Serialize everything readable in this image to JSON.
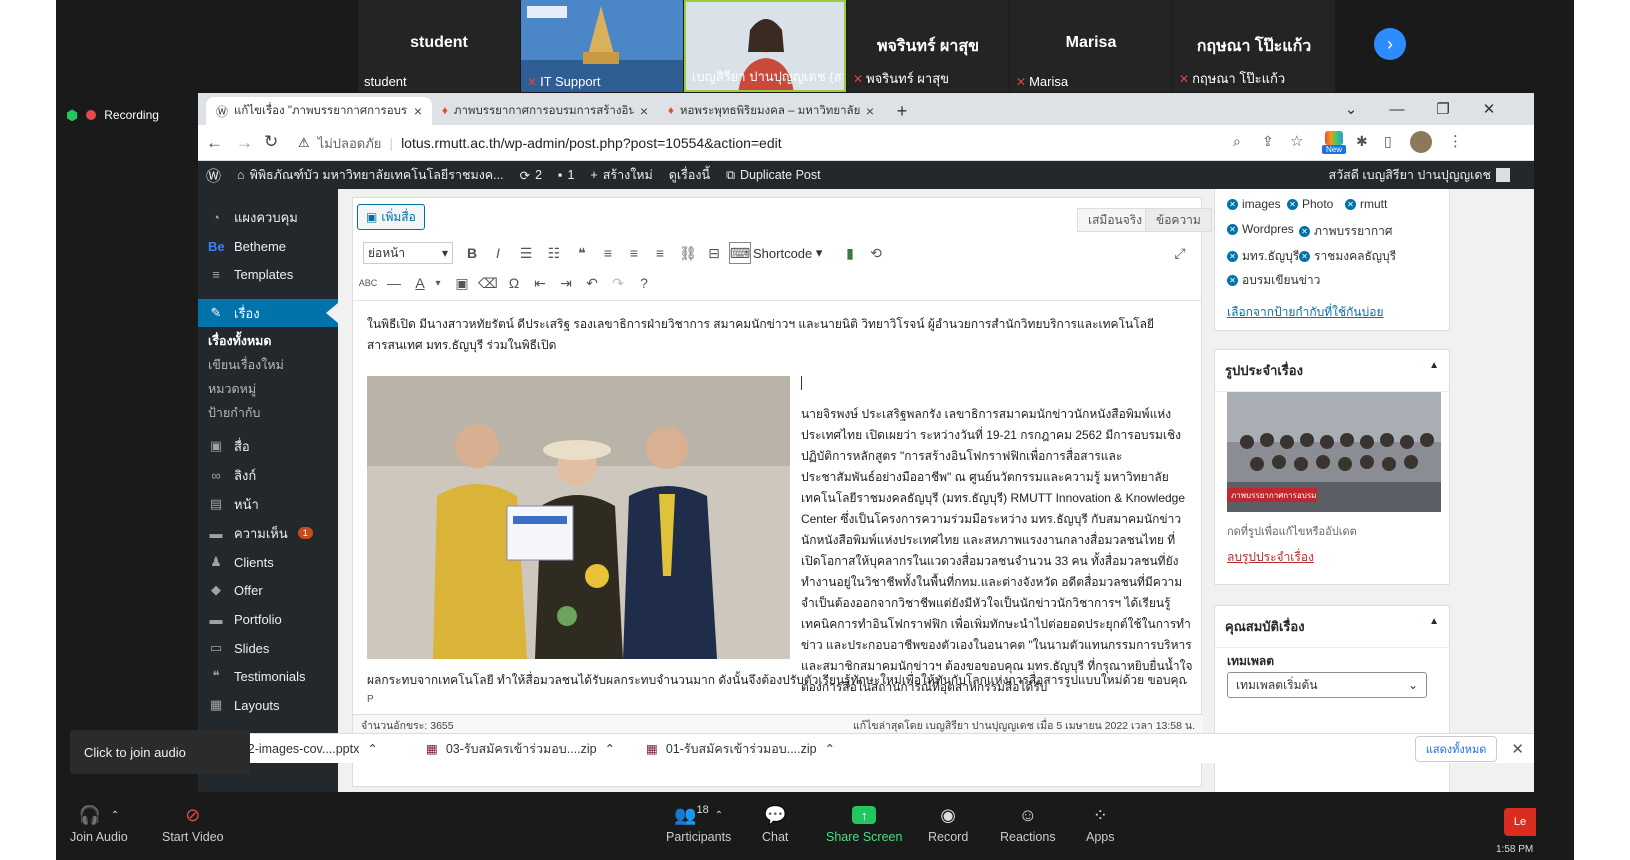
{
  "zoom": {
    "tiles": [
      {
        "big": "student",
        "small": "student"
      },
      {
        "big": "",
        "small": "IT Support"
      },
      {
        "big": "",
        "small": "เบญสิรียา ปานปุญญเดช (สวส)"
      },
      {
        "big": "พจรินทร์ ผาสุข",
        "small": "พจรินทร์ ผาสุข"
      },
      {
        "big": "Marisa",
        "small": "Marisa"
      },
      {
        "big": "กฤษณา โป๊ะแก้ว",
        "small": "กฤษณา โป๊ะแก้ว"
      }
    ],
    "recording_label": "Recording",
    "tooltip": "Click to join audio",
    "participants_count": "18",
    "toolbar": [
      {
        "label": "Join Audio",
        "icon": "headphones-icon"
      },
      {
        "label": "Start Video",
        "icon": "video-off-icon"
      },
      {
        "label": "Participants",
        "icon": "participants-icon"
      },
      {
        "label": "Chat",
        "icon": "chat-icon"
      },
      {
        "label": "Share Screen",
        "icon": "share-screen-icon"
      },
      {
        "label": "Record",
        "icon": "record-icon"
      },
      {
        "label": "Reactions",
        "icon": "reactions-icon"
      },
      {
        "label": "Apps",
        "icon": "apps-icon"
      }
    ],
    "right_edge_button": "Le",
    "clock": "1:58 PM",
    "share_color": "#22c55e"
  },
  "browser": {
    "tabs": [
      {
        "title": "แก้ไขเรื่อง \"ภาพบรรยากาศการอบรมเ"
      },
      {
        "title": "ภาพบรรยากาศการอบรมการสร้างอินโฟ"
      },
      {
        "title": "หอพระพุทธพิริยมงคล – มหาวิทยาลัยเ"
      }
    ],
    "insecure_label": "ไม่ปลอดภัย",
    "url": "lotus.rmutt.ac.th/wp-admin/post.php?post=10554&action=edit",
    "new_badge": "New"
  },
  "wp": {
    "adminbar": {
      "site": "พิพิธภัณฑ์บัว มหาวิทยาลัยเทคโนโลยีราชมงค...",
      "updates": "2",
      "comments": "1",
      "new": "สร้างใหม่",
      "view": "ดูเรื่องนี้",
      "duplicate": "Duplicate Post",
      "greeting": "สวัสดี เบญสิรียา ปานปุญญเดช"
    },
    "menu": [
      {
        "label": "แผงควบคุม",
        "icon": "dashboard-icon"
      },
      {
        "label": "Betheme",
        "icon": "betheme-icon"
      },
      {
        "label": "Templates",
        "icon": "templates-icon"
      },
      {
        "label": "เรื่อง",
        "icon": "pin-icon"
      },
      {
        "label": "สื่อ",
        "icon": "media-icon"
      },
      {
        "label": "ลิงก์",
        "icon": "link-icon"
      },
      {
        "label": "หน้า",
        "icon": "page-icon"
      },
      {
        "label": "ความเห็น",
        "icon": "comment-icon"
      },
      {
        "label": "Clients",
        "icon": "clients-icon"
      },
      {
        "label": "Offer",
        "icon": "offer-icon"
      },
      {
        "label": "Portfolio",
        "icon": "portfolio-icon"
      },
      {
        "label": "Slides",
        "icon": "slides-icon"
      },
      {
        "label": "Testimonials",
        "icon": "testimonials-icon"
      },
      {
        "label": "Layouts",
        "icon": "layouts-icon"
      }
    ],
    "submenu": [
      "เรื่องทั้งหมด",
      "เขียนเรื่องใหม่",
      "หมวดหมู่",
      "ป้ายกำกับ"
    ],
    "comments_badge": "1",
    "editor": {
      "add_media": "เพิ่มสื่อ",
      "visual_tab": "เสมือนจริง",
      "text_tab": "ข้อความ",
      "format": "ย่อหน้า",
      "shortcode": "Shortcode",
      "intro": "ในพิธีเปิด มีนางสาวหทัยรัตน์ ดีประเสริฐ รองเลขาธิการฝ่ายวิชาการ สมาคมนักข่าวฯ และนายนิติ วิทยาวิโรจน์ ผู้อำนวยการสำนักวิทยบริการและเทคโนโลยีสารสนเทศ มทร.ธัญบุรี ร่วมในพิธีเปิด",
      "body": "นายจิรพงษ์ ประเสริฐพลกรัง เลขาธิการสมาคมนักข่าวนักหนังสือพิมพ์แห่งประเทศไทย เปิดเผยว่า ระหว่างวันที่ 19-21 กรกฎาคม 2562 มีการอบรมเชิงปฏิบัติการหลักสูตร \"การสร้างอินโฟกราฟฟิกเพื่อการสื่อสารและประชาสัมพันธ์อย่างมืออาชีพ\" ณ ศูนย์นวัตกรรมและความรู้ มหาวิทยาลัยเทคโนโลยีราชมงคลธัญบุรี (มทร.ธัญบุรี) RMUTT Innovation & Knowledge Center ซึ่งเป็นโครงการความร่วมมือระหว่าง มทร.ธัญบุรี กับสมาคมนักข่าวนักหนังสือพิมพ์แห่งประเทศไทย และสหภาพแรงงานกลางสื่อมวลชนไทย ที่เปิดโอกาสให้บุคลากรในแวดวงสื่อมวลชนจำนวน 33 คน ทั้งสื่อมวลชนที่ยังทำงานอยู่ในวิชาชีพทั้งในพื้นที่กทม.และต่างจังหวัด อดีตสื่อมวลชนที่มีความจำเป็นต้องออกจากวิชาชีพแต่ยังมีหัวใจเป็นนักข่าวนักวิชาการฯ ได้เรียนรู้เทคนิคการทำอินโฟกราฟฟิก เพื่อเพิ่มทักษะนำไปต่อยอดประยุกต์ใช้ในการทำข่าว และประกอบอาชีพของตัวเองในอนาคต \"ในนามตัวแทนกรรมการบริหารและสมาชิกสมาคมนักข่าวฯ ต้องขอขอบคุณ มทร.ธัญบุรี ที่กรุณาหยิบยื่นน้ำใจต่องการสื่อในสถานการณ์ที่อุตสาหกรรมสื่อได้รับ",
      "bottom_line": "ผลกระทบจากเทคโนโลยี ทำให้สื่อมวลชนได้รับผลกระทบจำนวนมาก ดังนั้นจึงต้องปรับตัวเรียนรู้ทักษะใหม่เพื่อให้ทันกับโลกแห่งการสื่อสารรูปแบบใหม่ด้วย ขอบคุณที่เอื้อเฟื้อ",
      "path": "P",
      "word_count": "จำนวนอักขระ: 3655",
      "last_edit": "แก้ไขล่าสุดโดย เบญสิรียา ปานปุญญเดช เมื่อ 5 เมษายน 2022 เวลา 13:58 น."
    },
    "tags": [
      "images",
      "Photo",
      "rmutt",
      "Wordpres",
      "ภาพบรรยากาศ",
      "มทร.ธัญบุรี",
      "ราชมงคลธัญบุรี",
      "อบรมเขียนข่าว"
    ],
    "choose_tags": "เลือกจากป้ายกำกับที่ใช้กันบ่อย",
    "featured": {
      "title": "รูปประจำเรื่อง",
      "hint": "กดที่รูปเพื่อแก้ไขหรืออัปเดต",
      "remove": "ลบรูปประจำเรื่อง",
      "caption": "ภาพบรรยากาศการอบรม"
    },
    "attributes": {
      "title": "คุณสมบัติเรื่อง",
      "template_label": "เทมเพลต",
      "template_value": "เทมเพลตเริ่มต้น"
    }
  },
  "downloads": {
    "items": [
      "2022-images-cov....pptx",
      "03-รับสมัครเข้าร่วมอบ....zip",
      "01-รับสมัครเข้าร่วมอบ....zip"
    ],
    "show_all": "แสดงทั้งหมด"
  }
}
